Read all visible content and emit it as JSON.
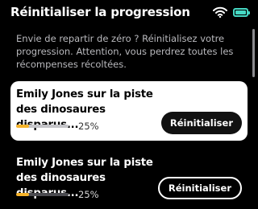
{
  "header": {
    "title": "Réinitialiser la progression"
  },
  "status": {
    "wifi_icon": "wifi-icon",
    "battery_icon": "battery-full-icon",
    "battery_color": "#46d9c4"
  },
  "intro": {
    "text": "Envie de repartir de zéro ? Réinitialisez votre progression. Attention, vous perdrez toutes les récompenses récoltées."
  },
  "items": [
    {
      "title": "Emily Jones sur la piste des dinosaures disparus...",
      "progress": 0.25,
      "progress_label": "25%",
      "button_label": "Réinitialiser",
      "selected": true
    },
    {
      "title": "Emily Jones sur la piste des dinosaures disparus...",
      "progress": 0.25,
      "progress_label": "25%",
      "button_label": "Réinitialiser",
      "selected": false
    }
  ],
  "colors": {
    "background": "#000000",
    "progress_accent": "#f7b42a",
    "card_selected_bg": "#ffffff"
  }
}
